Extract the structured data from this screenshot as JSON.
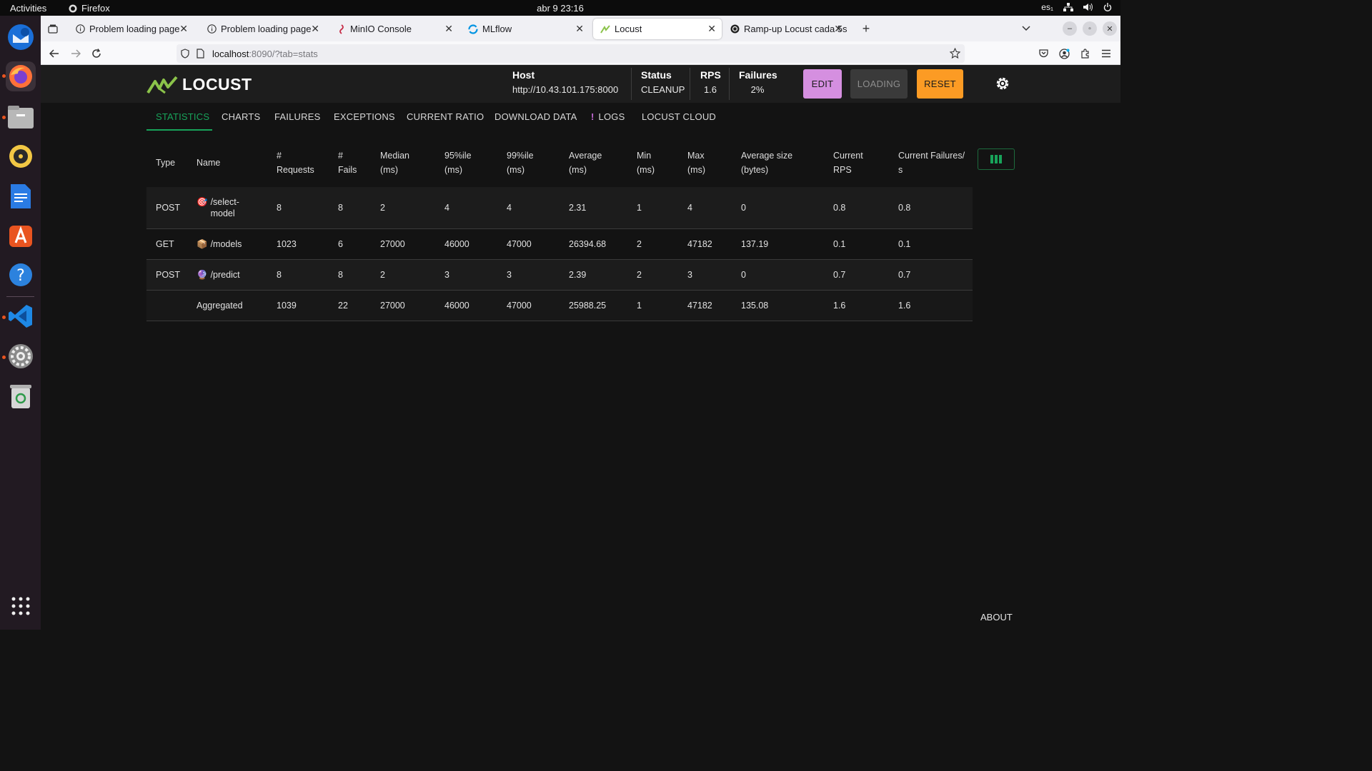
{
  "os": {
    "activities": "Activities",
    "app_name": "Firefox",
    "clock": "abr 9  23:16",
    "lang": "es₁"
  },
  "browser": {
    "tabs": [
      {
        "title": "Problem loading page",
        "active": false
      },
      {
        "title": "Problem loading page",
        "active": false
      },
      {
        "title": "MinIO Console",
        "active": false
      },
      {
        "title": "MLflow",
        "active": false
      },
      {
        "title": "Locust",
        "active": true
      },
      {
        "title": "Ramp-up Locust cada 5s",
        "active": false
      }
    ],
    "url_host": "localhost",
    "url_rest": ":8090/?tab=stats"
  },
  "locust": {
    "logo_text": "LOCUST",
    "host": {
      "label": "Host",
      "value": "http://10.43.101.175:8000"
    },
    "status": {
      "label": "Status",
      "value": "CLEANUP"
    },
    "rps": {
      "label": "RPS",
      "value": "1.6"
    },
    "failures": {
      "label": "Failures",
      "value": "2%"
    },
    "buttons": {
      "edit": "EDIT",
      "loading": "LOADING",
      "reset": "RESET"
    },
    "colors": {
      "edit": "#d58fe0",
      "loading": "#3a3a3a",
      "reset": "#fc9b24",
      "accent": "#18a35a"
    },
    "tabs": [
      "STATISTICS",
      "CHARTS",
      "FAILURES",
      "EXCEPTIONS",
      "CURRENT RATIO",
      "DOWNLOAD DATA",
      "LOGS",
      "LOCUST CLOUD"
    ],
    "logs_marker": "!",
    "columns": [
      [
        "Type"
      ],
      [
        "Name"
      ],
      [
        "#",
        "Requests"
      ],
      [
        "#",
        "Fails"
      ],
      [
        "Median",
        "(ms)"
      ],
      [
        "95%ile",
        "(ms)"
      ],
      [
        "99%ile",
        "(ms)"
      ],
      [
        "Average",
        "(ms)"
      ],
      [
        "Min",
        "(ms)"
      ],
      [
        "Max",
        "(ms)"
      ],
      [
        "Average size",
        "(bytes)"
      ],
      [
        "Current",
        "RPS"
      ],
      [
        "Current Failures/",
        "s"
      ]
    ],
    "rows": [
      {
        "type": "POST",
        "icon": "🎯",
        "name_lines": [
          "/select-",
          "model"
        ],
        "requests": "8",
        "fails": "8",
        "median": "2",
        "p95": "4",
        "p99": "4",
        "avg": "2.31",
        "min": "1",
        "max": "4",
        "size": "0",
        "rps": "0.8",
        "fps": "0.8"
      },
      {
        "type": "GET",
        "icon": "📦",
        "name_lines": [
          "/models"
        ],
        "requests": "1023",
        "fails": "6",
        "median": "27000",
        "p95": "46000",
        "p99": "47000",
        "avg": "26394.68",
        "min": "2",
        "max": "47182",
        "size": "137.19",
        "rps": "0.1",
        "fps": "0.1"
      },
      {
        "type": "POST",
        "icon": "🔮",
        "name_lines": [
          "/predict"
        ],
        "requests": "8",
        "fails": "8",
        "median": "2",
        "p95": "3",
        "p99": "3",
        "avg": "2.39",
        "min": "2",
        "max": "3",
        "size": "0",
        "rps": "0.7",
        "fps": "0.7"
      },
      {
        "type": "",
        "icon": "",
        "name_lines": [
          "Aggregated"
        ],
        "requests": "1039",
        "fails": "22",
        "median": "27000",
        "p95": "46000",
        "p99": "47000",
        "avg": "25988.25",
        "min": "1",
        "max": "47182",
        "size": "135.08",
        "rps": "1.6",
        "fps": "1.6"
      }
    ],
    "about": "ABOUT"
  }
}
